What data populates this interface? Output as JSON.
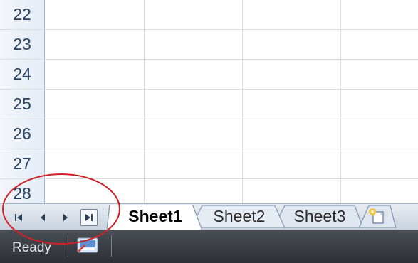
{
  "grid": {
    "rows": [
      "22",
      "23",
      "24",
      "25",
      "26",
      "27",
      "28"
    ]
  },
  "sheet_tabs": {
    "nav_icons": [
      "first-sheet-icon",
      "previous-sheet-icon",
      "next-sheet-icon",
      "last-sheet-icon"
    ],
    "tabs": [
      {
        "label": "Sheet1",
        "active": true
      },
      {
        "label": "Sheet2",
        "active": false
      },
      {
        "label": "Sheet3",
        "active": false
      }
    ],
    "insert_icon": "insert-worksheet-icon"
  },
  "status_bar": {
    "status": "Ready",
    "macro_icon": "record-macro-icon"
  },
  "colors": {
    "grid_line": "#dadcdd",
    "header_bg": "#e4ecf7",
    "annotation": "#d02028",
    "status_bar": "#3a3d43"
  }
}
